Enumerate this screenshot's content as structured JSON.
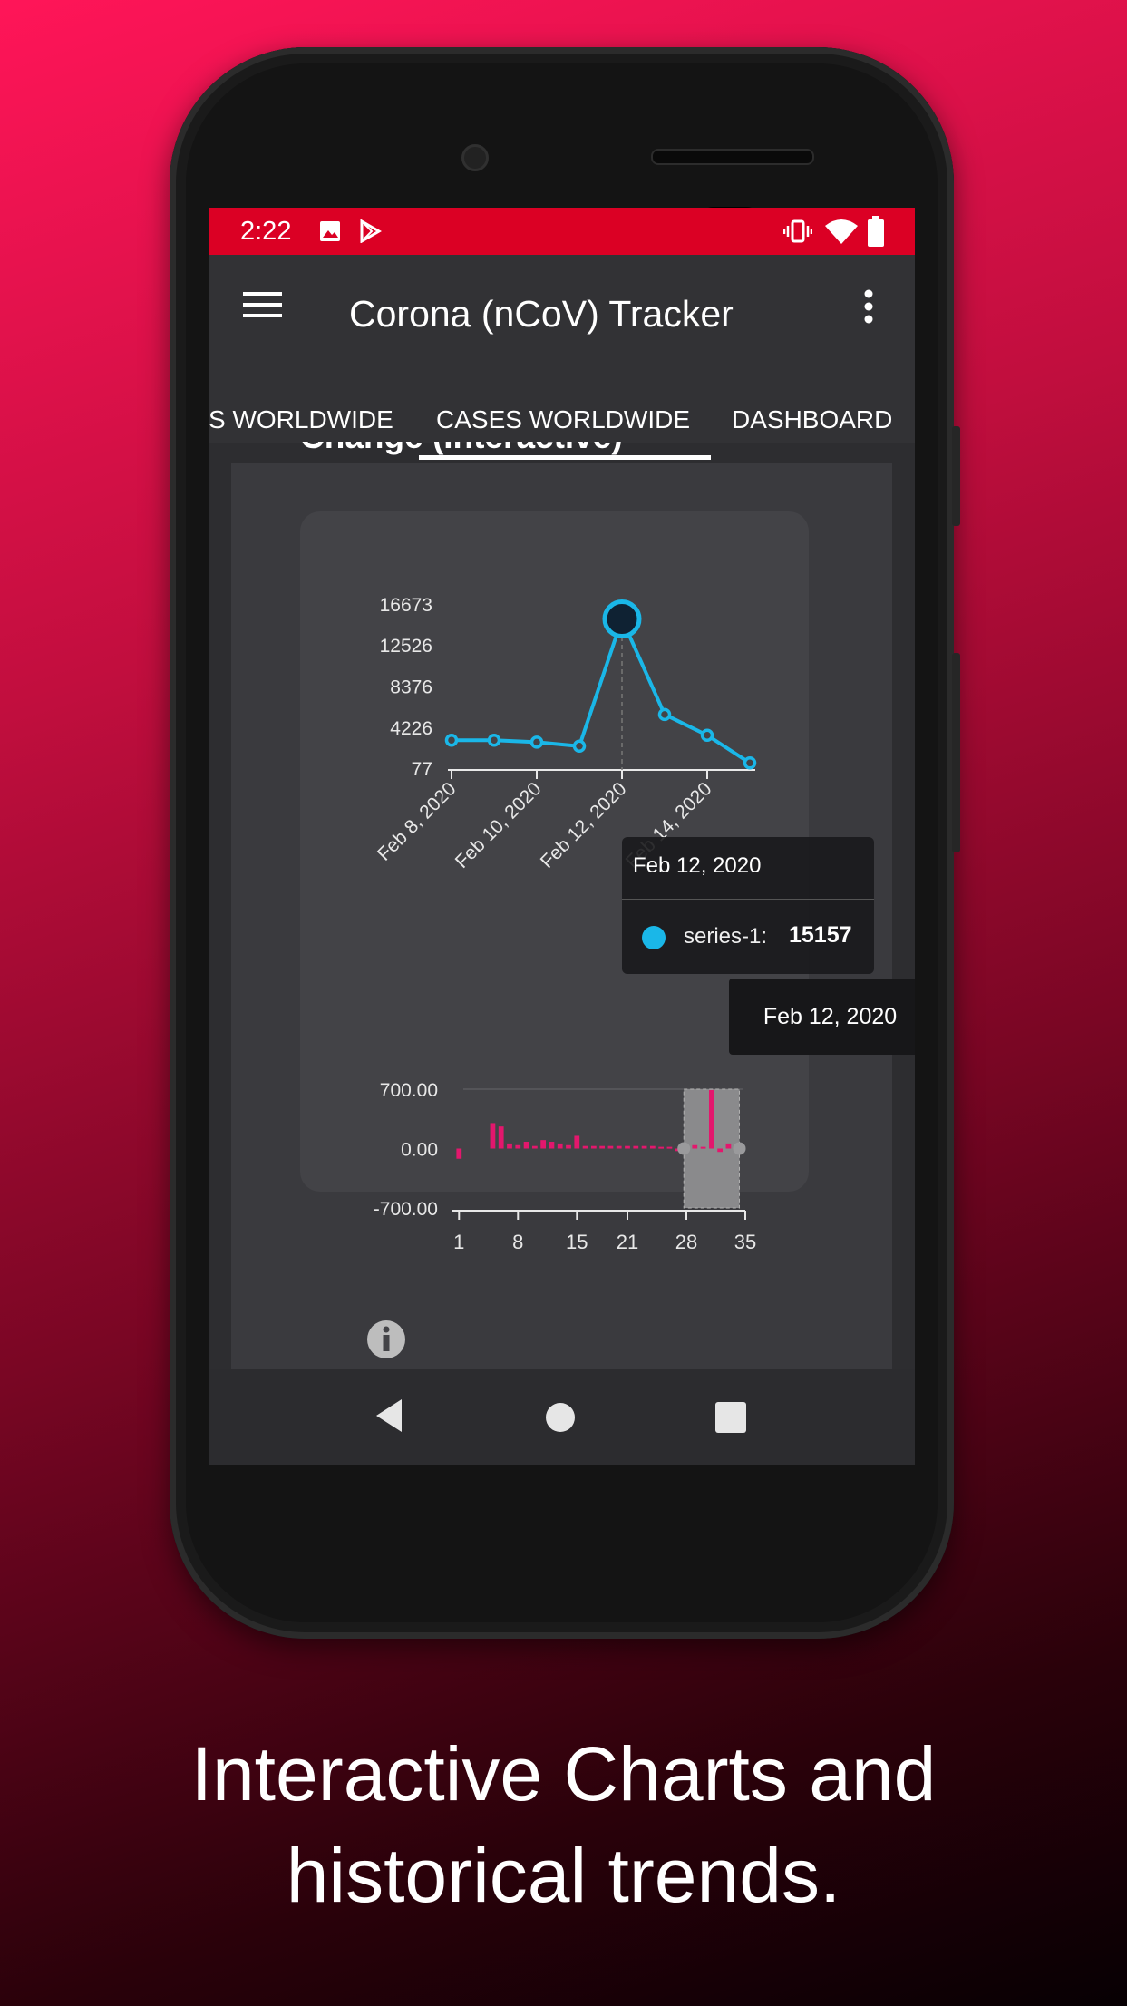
{
  "status": {
    "time": "2:22"
  },
  "appbar": {
    "title": "Corona (nCoV) Tracker"
  },
  "tabs": [
    {
      "label": "S WORLDWIDE",
      "active": false
    },
    {
      "label": "CASES WORLDWIDE",
      "active": true
    },
    {
      "label": "DASHBOARD",
      "active": false
    }
  ],
  "section": {
    "title": "Change (Interactive)"
  },
  "tooltip": {
    "date": "Feb 12, 2020",
    "series_label": "series-1:",
    "value": "15157"
  },
  "x_tooltip": {
    "date": "Feb 12, 2020"
  },
  "caption": {
    "line1": "Interactive Charts and",
    "line2": "historical trends."
  },
  "colors": {
    "status_bar": "#db0024",
    "line_series": "#1ab7e8",
    "bar_series": "#e3176d"
  },
  "icons": [
    "menu-icon",
    "more-vert-icon",
    "image-icon",
    "play-store-icon",
    "vibrate-icon",
    "wifi-icon",
    "battery-icon",
    "info-icon",
    "back-nav-icon",
    "home-nav-icon",
    "recents-nav-icon"
  ],
  "chart_data": [
    {
      "type": "line",
      "y_ticks": [
        "16673",
        "12526",
        "8376",
        "4226",
        "77"
      ],
      "x_ticks": [
        "Feb 8, 2020",
        "Feb 10, 2020",
        "Feb 12, 2020",
        "Feb 14, 2020"
      ],
      "x": [
        "Feb 8, 2020",
        "Feb 9, 2020",
        "Feb 10, 2020",
        "Feb 11, 2020",
        "Feb 12, 2020",
        "Feb 13, 2020",
        "Feb 14, 2020",
        "Feb 15, 2020"
      ],
      "series": [
        {
          "values": [
            2900,
            2900,
            2700,
            2300,
            15157,
            5500,
            3400,
            600
          ]
        }
      ],
      "ylim": [
        77,
        16673
      ],
      "grid": false
    },
    {
      "type": "bar",
      "y_ticks": [
        "700.00",
        "0.00",
        "-700.00"
      ],
      "x_ticks": [
        "1",
        "8",
        "15",
        "21",
        "28",
        "35"
      ],
      "x": [
        1,
        2,
        3,
        4,
        5,
        6,
        7,
        8,
        9,
        10,
        11,
        12,
        13,
        14,
        15,
        16,
        17,
        18,
        19,
        20,
        21,
        22,
        23,
        24,
        25,
        26,
        27,
        28,
        29,
        30,
        31,
        32,
        33,
        34
      ],
      "series": [
        {
          "values": [
            -120,
            0,
            0,
            0,
            300,
            260,
            60,
            40,
            80,
            30,
            100,
            80,
            60,
            40,
            150,
            30,
            30,
            30,
            30,
            30,
            30,
            30,
            30,
            30,
            20,
            20,
            -30,
            0,
            40,
            20,
            690,
            -40,
            60,
            40
          ]
        }
      ],
      "ylim": [
        -700,
        700
      ],
      "selection": [
        28,
        34
      ]
    }
  ]
}
